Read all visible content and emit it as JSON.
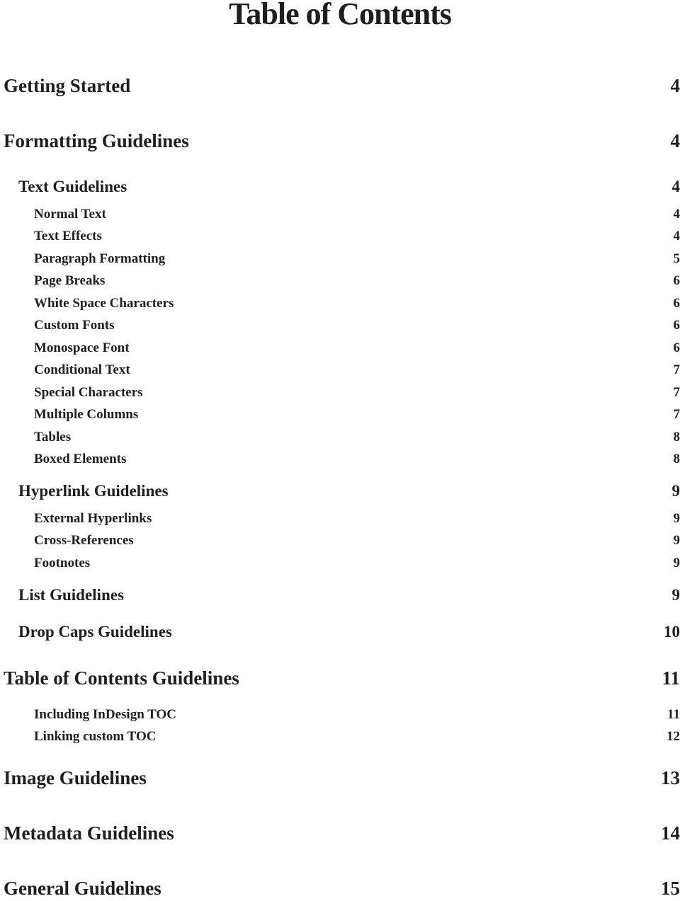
{
  "title": "Table of Contents",
  "entries": [
    {
      "label": "Getting Started",
      "page": "4"
    },
    {
      "label": "Formatting Guidelines",
      "page": "4"
    },
    {
      "label": "Text Guidelines",
      "page": "4"
    },
    {
      "label": "Normal Text",
      "page": "4"
    },
    {
      "label": "Text Effects",
      "page": "4"
    },
    {
      "label": "Paragraph Formatting",
      "page": "5"
    },
    {
      "label": "Page Breaks",
      "page": "6"
    },
    {
      "label": "White Space Characters",
      "page": "6"
    },
    {
      "label": "Custom Fonts",
      "page": "6"
    },
    {
      "label": "Monospace Font",
      "page": "6"
    },
    {
      "label": "Conditional Text",
      "page": "7"
    },
    {
      "label": "Special Characters",
      "page": "7"
    },
    {
      "label": "Multiple Columns",
      "page": "7"
    },
    {
      "label": "Tables",
      "page": "8"
    },
    {
      "label": "Boxed Elements",
      "page": "8"
    },
    {
      "label": "Hyperlink Guidelines",
      "page": "9"
    },
    {
      "label": "External Hyperlinks",
      "page": "9"
    },
    {
      "label": "Cross-References",
      "page": "9"
    },
    {
      "label": "Footnotes",
      "page": "9"
    },
    {
      "label": "List Guidelines",
      "page": "9"
    },
    {
      "label": "Drop Caps Guidelines",
      "page": "10"
    },
    {
      "label": "Table of Contents Guidelines",
      "page": "11"
    },
    {
      "label": "Including InDesign TOC",
      "page": "11"
    },
    {
      "label": "Linking custom TOC",
      "page": "12"
    },
    {
      "label": "Image Guidelines",
      "page": "13"
    },
    {
      "label": "Metadata Guidelines",
      "page": "14"
    },
    {
      "label": "General Guidelines",
      "page": "15"
    }
  ]
}
